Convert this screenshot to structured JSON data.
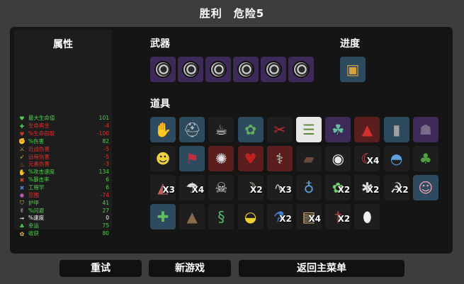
{
  "header": {
    "title": "胜利　危险5"
  },
  "stats": {
    "title": "属性",
    "rows": [
      {
        "label": "最大生命值",
        "value": "101",
        "label_color": "#4fd14f",
        "value_color": "#4fd14f",
        "icon": "heart-icon",
        "glyph": "♥",
        "icon_color": "#4fd14f"
      },
      {
        "label": "生命再生",
        "value": "-4",
        "label_color": "#e03030",
        "value_color": "#e03030",
        "icon": "regen-icon",
        "glyph": "✚",
        "icon_color": "#4fd14f"
      },
      {
        "label": "%生命窃取",
        "value": "-100",
        "label_color": "#e03030",
        "value_color": "#e03030",
        "icon": "lifesteal-icon",
        "glyph": "♥",
        "icon_color": "#c0392b"
      },
      {
        "label": "%伤害",
        "value": "82",
        "label_color": "#4fd14f",
        "value_color": "#4fd14f",
        "icon": "damage-icon",
        "glyph": "✊",
        "icon_color": "#e07070"
      },
      {
        "label": "近战伤害",
        "value": "-5",
        "label_color": "#e03030",
        "value_color": "#e03030",
        "icon": "melee-icon",
        "glyph": "⚔",
        "icon_color": "#e0a040"
      },
      {
        "label": "远程伤害",
        "value": "-5",
        "label_color": "#e03030",
        "value_color": "#e03030",
        "icon": "ranged-icon",
        "glyph": "➶",
        "icon_color": "#e0c040"
      },
      {
        "label": "元素伤害",
        "value": "-3",
        "label_color": "#e03030",
        "value_color": "#e03030",
        "icon": "elemental-icon",
        "glyph": "♨",
        "icon_color": "#e06020"
      },
      {
        "label": "%攻击速度",
        "value": "134",
        "label_color": "#4fd14f",
        "value_color": "#4fd14f",
        "icon": "attack-speed-icon",
        "glyph": "✋",
        "icon_color": "#e0a040"
      },
      {
        "label": "%暴击率",
        "value": "6",
        "label_color": "#4fd14f",
        "value_color": "#4fd14f",
        "icon": "crit-icon",
        "glyph": "✖",
        "icon_color": "#d04040"
      },
      {
        "label": "工程学",
        "value": "6",
        "label_color": "#4fd14f",
        "value_color": "#4fd14f",
        "icon": "engineering-icon",
        "glyph": "✖",
        "icon_color": "#5080e0"
      },
      {
        "label": "范围",
        "value": "-74",
        "label_color": "#e03030",
        "value_color": "#e03030",
        "icon": "range-icon",
        "glyph": "◉",
        "icon_color": "#d060d0"
      },
      {
        "label": "护甲",
        "value": "41",
        "label_color": "#4fd14f",
        "value_color": "#4fd14f",
        "icon": "armor-icon",
        "glyph": "⛉",
        "icon_color": "#e0c040"
      },
      {
        "label": "%闪避",
        "value": "27",
        "label_color": "#4fd14f",
        "value_color": "#4fd14f",
        "icon": "dodge-icon",
        "glyph": "✌",
        "icon_color": "#e0e0e0"
      },
      {
        "label": "%速度",
        "value": "0",
        "label_color": "#ffffff",
        "value_color": "#ffffff",
        "icon": "speed-icon",
        "glyph": "➟",
        "icon_color": "#e0e0e0"
      },
      {
        "label": "幸运",
        "value": "75",
        "label_color": "#4fd14f",
        "value_color": "#4fd14f",
        "icon": "luck-icon",
        "glyph": "♣",
        "icon_color": "#4fd14f"
      },
      {
        "label": "收获",
        "value": "80",
        "label_color": "#4fd14f",
        "value_color": "#4fd14f",
        "icon": "harvest-icon",
        "glyph": "✿",
        "icon_color": "#e0c040"
      }
    ]
  },
  "weapons": {
    "title": "武器",
    "items": [
      {
        "name": "weapon-slot-1",
        "tier": 3
      },
      {
        "name": "weapon-slot-2",
        "tier": 3
      },
      {
        "name": "weapon-slot-3",
        "tier": 3
      },
      {
        "name": "weapon-slot-4",
        "tier": 3
      },
      {
        "name": "weapon-slot-5",
        "tier": 3
      },
      {
        "name": "weapon-slot-6",
        "tier": 3
      }
    ]
  },
  "progress": {
    "title": "进度",
    "items": [
      {
        "icon": "crate-icon",
        "glyph": "▣",
        "tier": 2,
        "color": "#d8a040"
      }
    ]
  },
  "items": {
    "title": "道具",
    "rows": [
      [
        {
          "icon": "glove-icon",
          "glyph": "✋",
          "tier": 2,
          "color": "#a08060",
          "count": ""
        },
        {
          "icon": "knight-helmet-icon",
          "glyph": "⛑",
          "tier": 2,
          "color": "#c0c0c0",
          "count": ""
        },
        {
          "icon": "coffee-cup-icon",
          "glyph": "☕",
          "tier": 1,
          "color": "#e8e8e8",
          "count": ""
        },
        {
          "icon": "frog-icon",
          "glyph": "✿",
          "tier": 2,
          "color": "#60b060",
          "count": ""
        },
        {
          "icon": "red-claws-icon",
          "glyph": "✂",
          "tier": 1,
          "color": "#c03030",
          "count": ""
        },
        {
          "icon": "green-ladder-icon",
          "glyph": "☰",
          "tier": 0,
          "color": "#5a8a3a",
          "count": ""
        },
        {
          "icon": "chameleon-icon",
          "glyph": "☘",
          "tier": 3,
          "color": "#60c0a0",
          "count": ""
        },
        {
          "icon": "red-cape-icon",
          "glyph": "▲",
          "tier": 4,
          "color": "#d03030",
          "count": ""
        },
        {
          "icon": "bullet-icon",
          "glyph": "▮",
          "tier": 2,
          "color": "#a0a0a0",
          "count": ""
        },
        {
          "icon": "helmet-icon",
          "glyph": "☗",
          "tier": 3,
          "color": "#7a6a8a",
          "count": ""
        }
      ],
      [
        {
          "icon": "bee-icon",
          "glyph": "☻",
          "tier": 1,
          "color": "#f0d040",
          "count": ""
        },
        {
          "icon": "banner-icon",
          "glyph": "⚑",
          "tier": 2,
          "color": "#c03040",
          "count": ""
        },
        {
          "icon": "bloody-ring-icon",
          "glyph": "✺",
          "tier": 4,
          "color": "#e0e0e0",
          "count": ""
        },
        {
          "icon": "heart-organ-icon",
          "glyph": "♥",
          "tier": 4,
          "color": "#c02020",
          "count": ""
        },
        {
          "icon": "fork-icon",
          "glyph": "⚕",
          "tier": 4,
          "color": "#d0d0d0",
          "count": ""
        },
        {
          "icon": "wooden-plank-icon",
          "glyph": "▰",
          "tier": 1,
          "color": "#6a4a3a",
          "count": ""
        },
        {
          "icon": "eyeball-icon",
          "glyph": "◉",
          "tier": 1,
          "color": "#e8e8e8",
          "count": ""
        },
        {
          "icon": "red-mask-icon",
          "glyph": "☾",
          "tier": 1,
          "color": "#e04040",
          "count": "X4"
        },
        {
          "icon": "propeller-hat-icon",
          "glyph": "◓",
          "tier": 1,
          "color": "#60a0e0",
          "count": ""
        },
        {
          "icon": "tree-icon",
          "glyph": "♣",
          "tier": 1,
          "color": "#50a040",
          "count": ""
        }
      ],
      [
        {
          "icon": "cake-icon",
          "glyph": "◭",
          "tier": 1,
          "color": "#c06060",
          "count": "X3"
        },
        {
          "icon": "mushroom-icon",
          "glyph": "☂",
          "tier": 1,
          "color": "#e0e0e0",
          "count": "X4"
        },
        {
          "icon": "skull-mask-icon",
          "glyph": "☠",
          "tier": 1,
          "color": "#e0e0e0",
          "count": ""
        },
        {
          "icon": "horn-icon",
          "glyph": "☽",
          "tier": 1,
          "color": "#d0c0a0",
          "count": "X2"
        },
        {
          "icon": "snake-icon",
          "glyph": "∿",
          "tier": 1,
          "color": "#c0c0c0",
          "count": "X3"
        },
        {
          "icon": "potion-icon",
          "glyph": "♁",
          "tier": 1,
          "color": "#60a0e0",
          "count": ""
        },
        {
          "icon": "gummy-icon",
          "glyph": "✿",
          "tier": 1,
          "color": "#70d070",
          "count": "X2"
        },
        {
          "icon": "spider-icon",
          "glyph": "✱",
          "tier": 1,
          "color": "#e0e0e0",
          "count": "X2"
        },
        {
          "icon": "scythe-icon",
          "glyph": "☭",
          "tier": 1,
          "color": "#e0e0e0",
          "count": "X2"
        },
        {
          "icon": "pig-icon",
          "glyph": "☺",
          "tier": 2,
          "color": "#f0a0b0",
          "count": ""
        }
      ],
      [
        {
          "icon": "medkit-icon",
          "glyph": "✚",
          "tier": 2,
          "color": "#60c060",
          "count": ""
        },
        {
          "icon": "dirt-pile-icon",
          "glyph": "▲",
          "tier": 1,
          "color": "#8a6a4a",
          "count": ""
        },
        {
          "icon": "green-worm-icon",
          "glyph": "§",
          "tier": 1,
          "color": "#50c070",
          "count": ""
        },
        {
          "icon": "rubber-duck-icon",
          "glyph": "◒",
          "tier": 1,
          "color": "#f0d030",
          "count": ""
        },
        {
          "icon": "tube-icon",
          "glyph": "⚗",
          "tier": 1,
          "color": "#4080d0",
          "count": "X2"
        },
        {
          "icon": "bandage-icon",
          "glyph": "▤",
          "tier": 1,
          "color": "#d0b080",
          "count": "X4"
        },
        {
          "icon": "dagger-icon",
          "glyph": "†",
          "tier": 1,
          "color": "#c04040",
          "count": "X2"
        },
        {
          "icon": "egg-icon",
          "glyph": "⬮",
          "tier": 1,
          "color": "#f0f0f0",
          "count": ""
        }
      ]
    ]
  },
  "buttons": {
    "retry": "重试",
    "new_game": "新游戏",
    "main_menu": "返回主菜单"
  }
}
